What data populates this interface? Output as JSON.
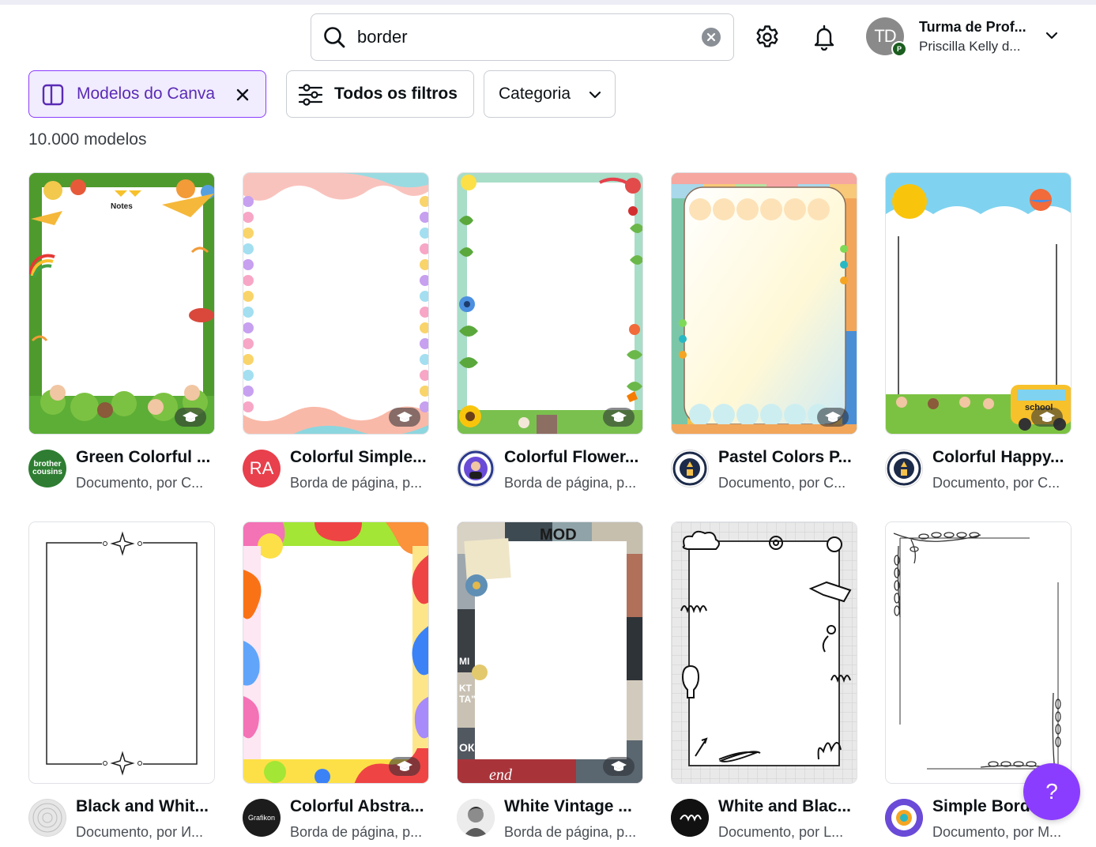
{
  "search": {
    "value": "border"
  },
  "account": {
    "initials": "TD",
    "badge": "P",
    "team": "Turma de Prof...",
    "user": "Priscilla Kelly d..."
  },
  "filters": {
    "active_chip": "Modelos do Canva",
    "all_filters": "Todos os filtros",
    "category": "Categoria"
  },
  "results": {
    "count": "10.000 modelos"
  },
  "cards": [
    {
      "title": "Green Colorful ...",
      "subtitle": "Documento, por C...",
      "creator_text": "brother cousins",
      "creator_color": "#2e7d32",
      "thumb_label": "Notes"
    },
    {
      "title": "Colorful Simple...",
      "subtitle": "Borda de página, p...",
      "creator_text": "RA",
      "creator_color": "#e8404c"
    },
    {
      "title": "Colorful Flower...",
      "subtitle": "Borda de página, p...",
      "creator_text": "",
      "creator_color": "#ffffff"
    },
    {
      "title": "Pastel Colors P...",
      "subtitle": "Documento, por C...",
      "creator_text": "",
      "creator_color": "#ffffff"
    },
    {
      "title": "Colorful Happy...",
      "subtitle": "Documento, por C...",
      "creator_text": "",
      "creator_color": "#ffffff",
      "thumb_label": "school"
    },
    {
      "title": "Black and Whit...",
      "subtitle": "Documento, por И...",
      "creator_text": "",
      "creator_color": "#d9d9d9"
    },
    {
      "title": "Colorful Abstra...",
      "subtitle": "Borda de página, p...",
      "creator_text": "Grafikon",
      "creator_color": "#1c1c1c"
    },
    {
      "title": "White Vintage ...",
      "subtitle": "Borda de página, p...",
      "creator_text": "",
      "creator_color": "#cfcfcf",
      "thumb_labels": [
        "MOD",
        "MI",
        "KT",
        "TA\"",
        "ОК",
        "end"
      ]
    },
    {
      "title": "White and Blac...",
      "subtitle": "Documento, por L...",
      "creator_text": "",
      "creator_color": "#111111"
    },
    {
      "title": "Simple Bord...",
      "subtitle": "Documento, por M...",
      "creator_text": "",
      "creator_color": "#6a4bd8"
    }
  ],
  "help": {
    "label": "?"
  },
  "colors": {
    "accent": "#8b3dff",
    "chip_bg": "#f1ecfe",
    "chip_text": "#5a2bb5"
  }
}
